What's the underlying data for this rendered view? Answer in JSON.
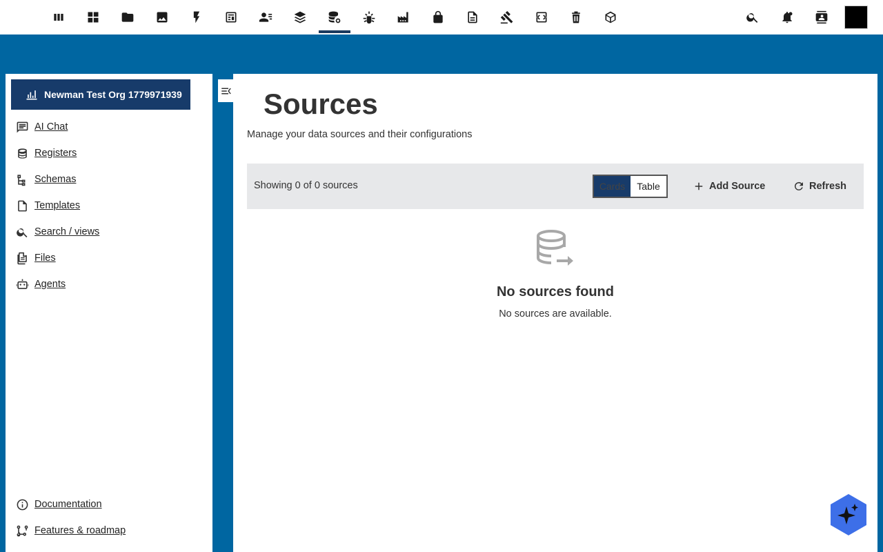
{
  "topnav": {
    "items": [
      {
        "icon": "grid-columns-icon"
      },
      {
        "icon": "dashboard-icon"
      },
      {
        "icon": "folder-icon"
      },
      {
        "icon": "image-icon"
      },
      {
        "icon": "lightning-icon"
      },
      {
        "icon": "table-calc-icon"
      },
      {
        "icon": "contacts-list-icon"
      },
      {
        "icon": "layers-icon"
      },
      {
        "icon": "database-settings-icon",
        "active": true
      },
      {
        "icon": "bug-icon"
      },
      {
        "icon": "factory-icon"
      },
      {
        "icon": "lock-icon"
      },
      {
        "icon": "document-icon"
      },
      {
        "icon": "gavel-icon"
      },
      {
        "icon": "code-window-icon"
      },
      {
        "icon": "trash-icon"
      },
      {
        "icon": "cube-icon"
      }
    ],
    "right": [
      {
        "icon": "search-icon"
      },
      {
        "icon": "notifications-icon"
      },
      {
        "icon": "contact-card-icon"
      }
    ]
  },
  "sidebar": {
    "org_label": "Newman Test Org 1779971939",
    "items": [
      {
        "label": "AI Chat",
        "icon": "chat-icon"
      },
      {
        "label": "Registers",
        "icon": "database-icon"
      },
      {
        "label": "Schemas",
        "icon": "tree-icon"
      },
      {
        "label": "Templates",
        "icon": "file-icon"
      },
      {
        "label": "Search / views",
        "icon": "search-icon"
      },
      {
        "label": "Files",
        "icon": "files-icon"
      },
      {
        "label": "Agents",
        "icon": "robot-icon"
      }
    ],
    "bottom_items": [
      {
        "label": "Documentation",
        "icon": "info-icon"
      },
      {
        "label": "Features & roadmap",
        "icon": "roadmap-icon"
      }
    ]
  },
  "main": {
    "title": "Sources",
    "subtitle": "Manage your data sources and their configurations",
    "toolbar": {
      "count_text": "Showing 0 of 0 sources",
      "view_options": [
        "Cards",
        "Table"
      ],
      "selected_view": "Cards",
      "add_label": "Add Source",
      "refresh_label": "Refresh"
    },
    "empty": {
      "title": "No sources found",
      "description": "No sources are available."
    }
  },
  "colors": {
    "background": "#0066a1",
    "accent": "#173b6a",
    "fab": "#3d6fe8"
  }
}
